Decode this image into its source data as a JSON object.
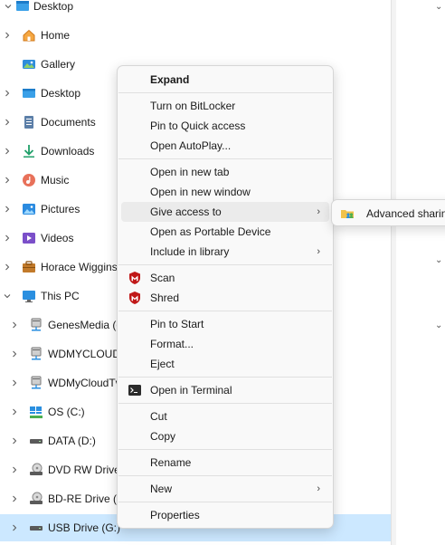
{
  "nav": {
    "items": [
      {
        "label": "Desktop",
        "icon": "desktop-folder-icon",
        "expanded": true
      },
      {
        "label": "Home",
        "icon": "home-icon"
      },
      {
        "label": "Gallery",
        "icon": "gallery-icon"
      },
      {
        "label": "Desktop",
        "icon": "desktop-folder-icon"
      },
      {
        "label": "Documents",
        "icon": "documents-icon"
      },
      {
        "label": "Downloads",
        "icon": "downloads-icon"
      },
      {
        "label": "Music",
        "icon": "music-icon"
      },
      {
        "label": "Pictures",
        "icon": "pictures-icon"
      },
      {
        "label": "Videos",
        "icon": "videos-icon"
      },
      {
        "label": "Horace Wiggins",
        "icon": "user-folder-icon"
      },
      {
        "label": "This PC",
        "icon": "this-pc-icon",
        "expanded": true
      },
      {
        "label": "GenesMedia (d",
        "icon": "network-drive-icon"
      },
      {
        "label": "WDMYCLOUD",
        "icon": "network-drive-icon"
      },
      {
        "label": "WDMyCloudTv",
        "icon": "network-drive-icon"
      },
      {
        "label": "OS (C:)",
        "icon": "windows-drive-icon"
      },
      {
        "label": "DATA (D:)",
        "icon": "drive-icon"
      },
      {
        "label": "DVD RW Drive",
        "icon": "optical-drive-icon"
      },
      {
        "label": "BD-RE Drive (F",
        "icon": "optical-drive-icon"
      },
      {
        "label": "USB Drive (G:)",
        "icon": "usb-drive-icon",
        "selected": true
      }
    ]
  },
  "context_menu": {
    "items": [
      {
        "label": "Expand",
        "bold": true
      },
      {
        "label": "Turn on BitLocker"
      },
      {
        "label": "Pin to Quick access"
      },
      {
        "label": "Open AutoPlay..."
      },
      {
        "label": "Open in new tab"
      },
      {
        "label": "Open in new window"
      },
      {
        "label": "Give access to",
        "submenu": true,
        "hover": true
      },
      {
        "label": "Open as Portable Device"
      },
      {
        "label": "Include in library",
        "submenu": true
      },
      {
        "label": "Scan",
        "icon": "mcafee-icon"
      },
      {
        "label": "Shred",
        "icon": "mcafee-icon"
      },
      {
        "label": "Pin to Start"
      },
      {
        "label": "Format..."
      },
      {
        "label": "Eject"
      },
      {
        "label": "Open in Terminal",
        "icon": "terminal-icon"
      },
      {
        "label": "Cut"
      },
      {
        "label": "Copy"
      },
      {
        "label": "Rename"
      },
      {
        "label": "New",
        "submenu": true
      },
      {
        "label": "Properties"
      }
    ]
  },
  "submenu": {
    "items": [
      {
        "label": "Advanced sharing",
        "icon": "sharing-folder-icon"
      }
    ]
  },
  "colors": {
    "selected_row": "#cce8ff",
    "menu_bg": "#f9f9f9",
    "menu_hover": "#ebebeb",
    "mcafee_red": "#c01818"
  }
}
